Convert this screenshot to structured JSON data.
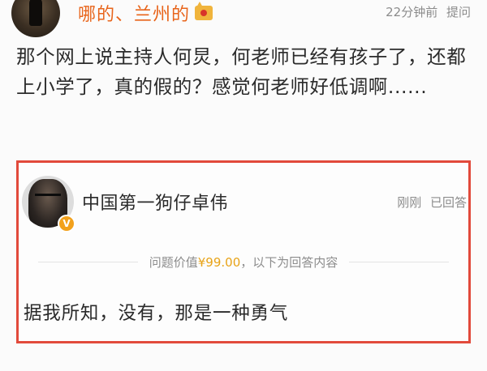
{
  "question": {
    "asker_name": "哪的、兰州的",
    "time": "22分钟前",
    "role": "提问",
    "text": "那个网上说主持人何炅，何老师已经有孩子了，还都上小学了，真的假的？感觉何老师好低调啊......"
  },
  "answer": {
    "answerer_name": "中国第一狗仔卓伟",
    "time": "刚刚",
    "status": "已回答",
    "verified_badge": "V",
    "value_prefix": "问题价值",
    "price": "¥99.00",
    "value_suffix": "，以下为回答内容",
    "text": "据我所知，没有，那是一种勇气"
  },
  "colors": {
    "asker_name": "#e8641a",
    "price": "#e8a317",
    "highlight_border": "#e24a3b",
    "meta_text": "#8c8c8c"
  },
  "icons": {
    "crown": "crown-icon",
    "verified": "verified-v-icon"
  }
}
